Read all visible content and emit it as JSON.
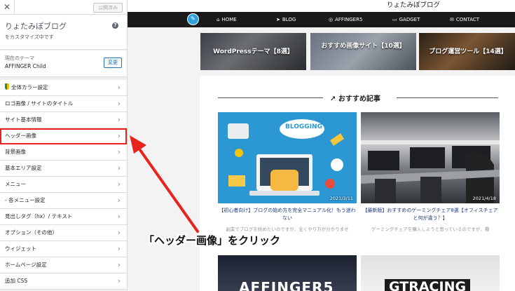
{
  "sidebar": {
    "close_glyph": "✕",
    "publish_label": "公開済み",
    "site_name": "りょたみぽブログ",
    "customizing_text": "をカスタマイズ中です",
    "help_glyph": "?",
    "theme_label": "現在のテーマ",
    "theme_name": "AFFINGER Child",
    "change_label": "変更",
    "items": [
      {
        "label": "全体カラー設定",
        "icon": "shield-icon"
      },
      {
        "label": "ロゴ画像 / サイトのタイトル"
      },
      {
        "label": "サイト基本情報"
      },
      {
        "label": "ヘッダー画像",
        "highlighted": true
      },
      {
        "label": "背景画像"
      },
      {
        "label": "基本エリア設定"
      },
      {
        "label": "メニュー"
      },
      {
        "label": "- 各メニュー設定"
      },
      {
        "label": "見出しタグ（hx）/ テキスト"
      },
      {
        "label": "オプション（その他）"
      },
      {
        "label": "ウィジェット"
      },
      {
        "label": "ホームページ設定"
      },
      {
        "label": "追加 CSS"
      }
    ],
    "chevron": "›"
  },
  "preview": {
    "site_title": "りょたみぽブログ",
    "nav": [
      {
        "label": "HOME",
        "icon": "home-icon",
        "glyph": "⌂"
      },
      {
        "label": "BLOG",
        "icon": "send-icon",
        "glyph": "➤"
      },
      {
        "label": "AFFINGER5",
        "icon": "wordpress-icon",
        "glyph": "◎"
      },
      {
        "label": "GADGET",
        "icon": "gamepad-icon",
        "glyph": "▭"
      },
      {
        "label": "CONTACT",
        "icon": "mail-icon",
        "glyph": "✉"
      }
    ],
    "pencil_glyph": "✎",
    "top_cards": [
      {
        "label": "WordPressテーマ【8選】"
      },
      {
        "label": "おすすめ画像サイト【10選】"
      },
      {
        "label": "ブログ運営ツール【14選】"
      }
    ],
    "section_title": "おすすめ記事",
    "section_icon": "trend-icon",
    "articles": [
      {
        "image_text": "BLOGGING",
        "date": "2021/3/11",
        "title": "【初心者向け】ブログの始め方を完全マニュアル化！もう迷わない",
        "excerpt": "副業でブログを始めたいのですが、全くやり方が分かりませ"
      },
      {
        "date": "2021/4/18",
        "title": "【最新版】おすすめのゲーミングチェア8選【オフィスチェアと何が違う？】",
        "excerpt": "ゲーミングチェアを購入しようと思っているのですが、種"
      }
    ],
    "bottom_cards": [
      {
        "image_text": "AFFINGER5"
      },
      {
        "image_text": "GTRACING"
      }
    ]
  },
  "annotation": {
    "text": "「ヘッダー画像」をクリック",
    "color": "#e8231d"
  }
}
